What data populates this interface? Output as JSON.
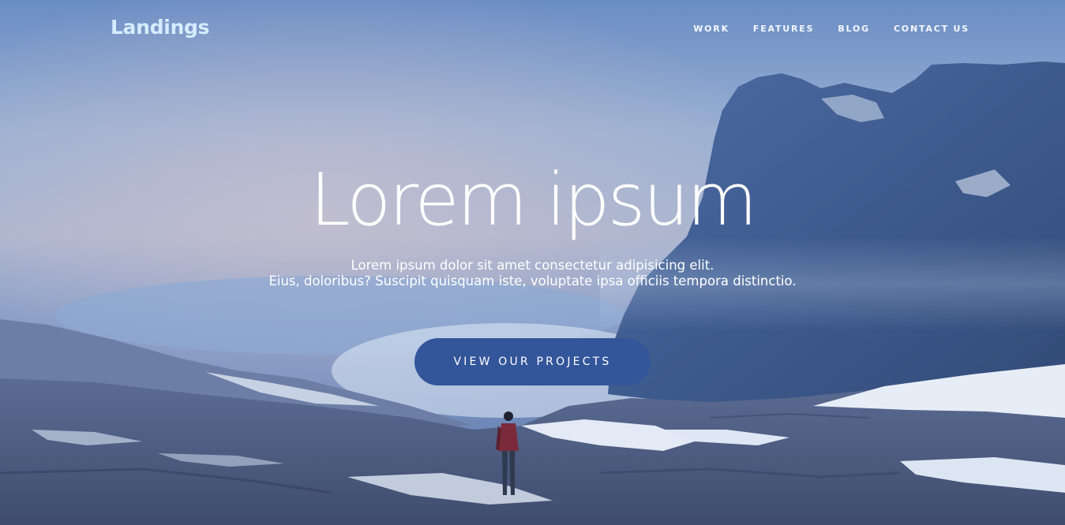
{
  "brand": {
    "name": "Landings"
  },
  "nav": {
    "items": [
      {
        "label": "WORK"
      },
      {
        "label": "FEATURES"
      },
      {
        "label": "BLOG"
      },
      {
        "label": "CONTACT US"
      }
    ]
  },
  "hero": {
    "title": "Lorem ipsum",
    "subtitle_line1": "Lorem ipsum dolor sit amet consectetur adipisicing elit.",
    "subtitle_line2": "Eius, doloribus? Suscipit quisquam iste, voluptate ipsa officiis tempora distinctio.",
    "cta_label": "VIEW OUR PROJECTS",
    "background_image": "mountain-landscape-hiker"
  },
  "colors": {
    "button": "#33559a",
    "logo": "#d6ecff",
    "text": "#ffffff"
  }
}
